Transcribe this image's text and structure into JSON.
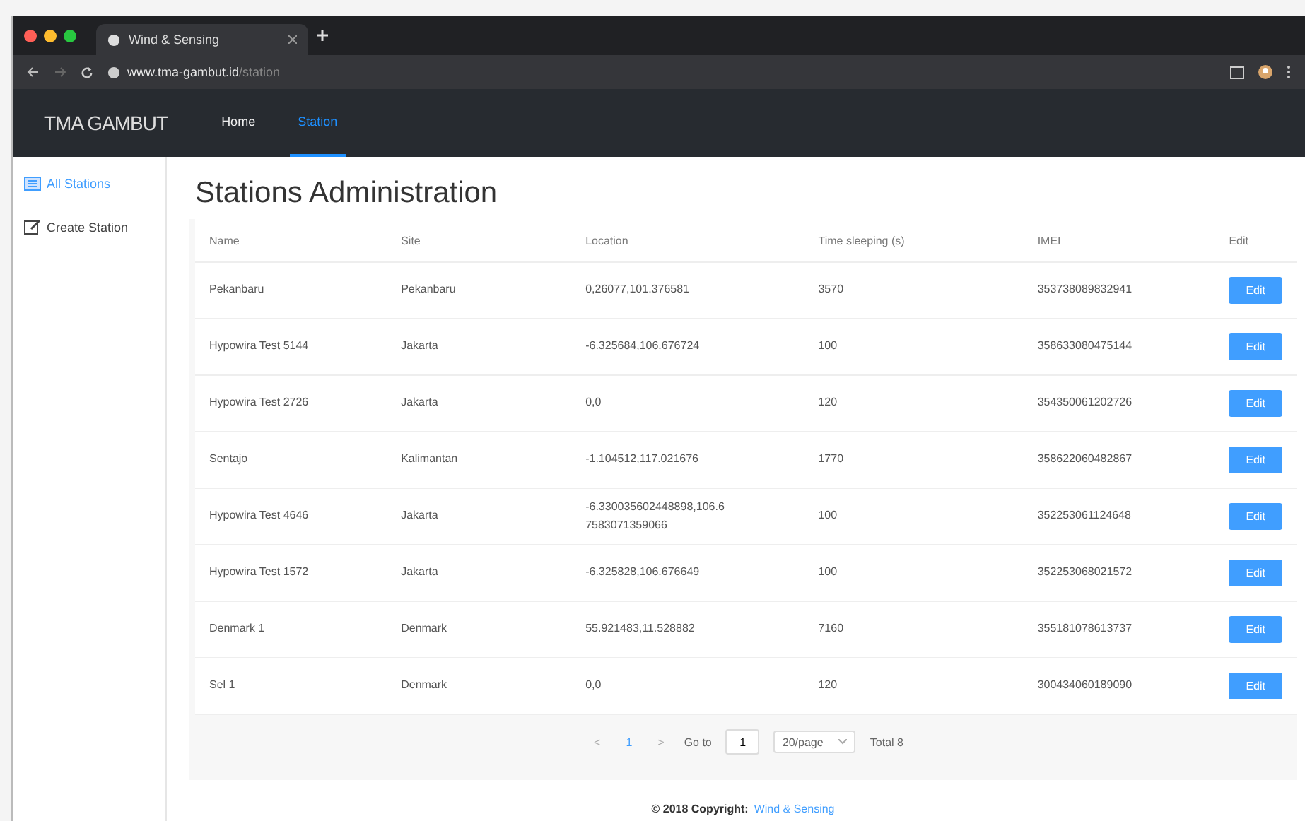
{
  "browser": {
    "tab_title": "Wind & Sensing",
    "url_host": "www.tma-gambut.id",
    "url_path": "/station"
  },
  "navbar": {
    "brand": "TMA GAMBUT",
    "items": [
      {
        "label": "Home",
        "selected": false
      },
      {
        "label": "Station",
        "selected": true
      }
    ]
  },
  "sidebar": {
    "items": [
      {
        "label": "All Stations",
        "kind": "list",
        "selected": true
      },
      {
        "label": "Create Station",
        "kind": "edit",
        "selected": false
      }
    ]
  },
  "page_title": "Stations Administration",
  "table": {
    "columns": [
      "Name",
      "Site",
      "Location",
      "Time sleeping (s)",
      "IMEI",
      "Edit"
    ],
    "rows": [
      {
        "cells": [
          "Pekanbaru",
          "Pekanbaru",
          "0,26077,101.376581",
          "3570",
          "353738089832941"
        ],
        "action": "Edit"
      },
      {
        "cells": [
          "Hypowira Test 5144",
          "Jakarta",
          "-6.325684,106.676724",
          "100",
          "358633080475144"
        ],
        "action": "Edit"
      },
      {
        "cells": [
          "Hypowira Test 2726",
          "Jakarta",
          "0,0",
          "120",
          "354350061202726"
        ],
        "action": "Edit"
      },
      {
        "cells": [
          "Sentajo",
          "Kalimantan",
          "-1.104512,117.021676",
          "1770",
          "358622060482867"
        ],
        "action": "Edit"
      },
      {
        "cells": [
          "Hypowira Test 4646",
          "Jakarta",
          "-6.330035602448898,106.67583071359066",
          "100",
          "352253061124648"
        ],
        "action": "Edit"
      },
      {
        "cells": [
          "Hypowira Test 1572",
          "Jakarta",
          "-6.325828,106.676649",
          "100",
          "352253068021572"
        ],
        "action": "Edit"
      },
      {
        "cells": [
          "Denmark 1",
          "Denmark",
          "55.921483,11.528882",
          "7160",
          "355181078613737"
        ],
        "action": "Edit"
      },
      {
        "cells": [
          "Sel 1",
          "Denmark",
          "0,0",
          "120",
          "300434060189090"
        ],
        "action": "Edit"
      }
    ]
  },
  "pagination": {
    "prev": "<",
    "pages": [
      {
        "label": "1",
        "selected": true
      }
    ],
    "next": ">",
    "goto_label": "Go to",
    "goto_value": "1",
    "page_size": "20/page",
    "total": "Total 8"
  },
  "footer": {
    "text": "© 2018 Copyright:",
    "link": "Wind & Sensing"
  }
}
